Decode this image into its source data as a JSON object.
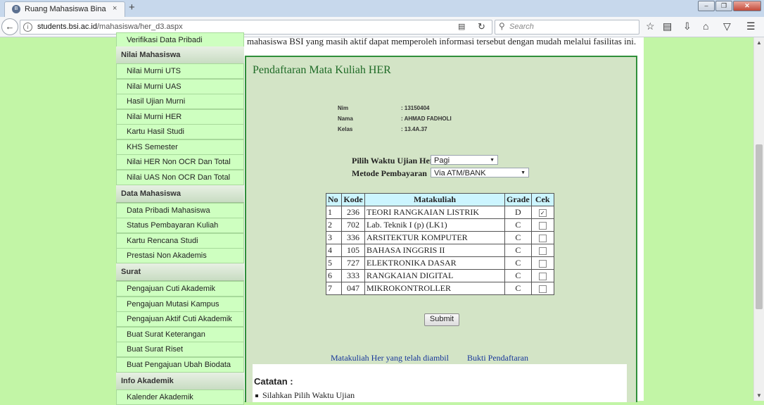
{
  "browser": {
    "tab_title": "Ruang Mahasiswa Bina Saran",
    "tab_close": "×",
    "new_tab": "+",
    "url_domain": "students.bsi.ac.id",
    "url_path": "/mahasiswa/her_d3.aspx",
    "search_placeholder": "Search",
    "window_buttons": [
      "–",
      "❐",
      "✕"
    ]
  },
  "sidebar": {
    "cut_item": "Verifikasi Data Pribadi",
    "sections": [
      {
        "heading": "Nilai Mahasiswa",
        "items": [
          "Nilai Murni UTS",
          "Nilai Murni UAS",
          "Hasil Ujian Murni",
          "Nilai Murni HER",
          "Kartu Hasil Studi",
          "KHS Semester",
          "Nilai HER Non OCR Dan Total",
          "Nilai UAS Non OCR Dan Total"
        ]
      },
      {
        "heading": "Data Mahasiswa",
        "items": [
          "Data Pribadi Mahasiswa",
          "Status Pembayaran Kuliah",
          "Kartu Rencana Studi",
          "Prestasi Non Akademis"
        ]
      },
      {
        "heading": "Surat",
        "items": [
          "Pengajuan Cuti Akademik",
          "Pengajuan Mutasi Kampus",
          "Pengajuan Aktif Cuti Akademik",
          "Buat Surat Keterangan",
          "Buat Surat Riset",
          "Buat Pengajuan Ubah Biodata"
        ]
      },
      {
        "heading": "Info Akademik",
        "items": [
          "Kalender Akademik"
        ]
      }
    ]
  },
  "main": {
    "intro_text": "mahasiswa BSI yang masih aktif dapat memperoleh informasi tersebut dengan mudah melalui fasilitas ini.",
    "title": "Pendaftaran Mata Kuliah HER",
    "student": {
      "nim_label": "Nim",
      "nim_value": ": 13150404",
      "nama_label": "Nama",
      "nama_value": ": AHMAD FADHOLI",
      "kelas_label": "Kelas",
      "kelas_value": ": 13.4A.37"
    },
    "waktu_label": "Pilih Waktu Ujian Her",
    "waktu_value": "Pagi",
    "metode_label": "Metode Pembayaran",
    "metode_value": "Via ATM/BANK",
    "table": {
      "headers": [
        "No",
        "Kode",
        "Matakuliah",
        "Grade",
        "Cek"
      ],
      "rows": [
        {
          "no": "1",
          "kode": "236",
          "matakuliah": "TEORI RANGKAIAN LISTRIK",
          "grade": "D",
          "checked": true
        },
        {
          "no": "2",
          "kode": "702",
          "matakuliah": "Lab. Teknik I (p) (LK1)",
          "grade": "C",
          "checked": false
        },
        {
          "no": "3",
          "kode": "336",
          "matakuliah": "ARSITEKTUR KOMPUTER",
          "grade": "C",
          "checked": false
        },
        {
          "no": "4",
          "kode": "105",
          "matakuliah": "BAHASA INGGRIS II",
          "grade": "C",
          "checked": false
        },
        {
          "no": "5",
          "kode": "727",
          "matakuliah": "ELEKTRONIKA DASAR",
          "grade": "C",
          "checked": false
        },
        {
          "no": "6",
          "kode": "333",
          "matakuliah": "RANGKAIAN DIGITAL",
          "grade": "C",
          "checked": false
        },
        {
          "no": "7",
          "kode": "047",
          "matakuliah": "MIKROKONTROLLER",
          "grade": "C",
          "checked": false
        }
      ]
    },
    "submit_label": "Submit",
    "link_taken": "Matakuliah Her yang telah diambil",
    "link_bukti": "Bukti Pendaftaran",
    "catatan_title": "Catatan :",
    "catatan_items": [
      "Silahkan Pilih Waktu Ujian"
    ]
  }
}
